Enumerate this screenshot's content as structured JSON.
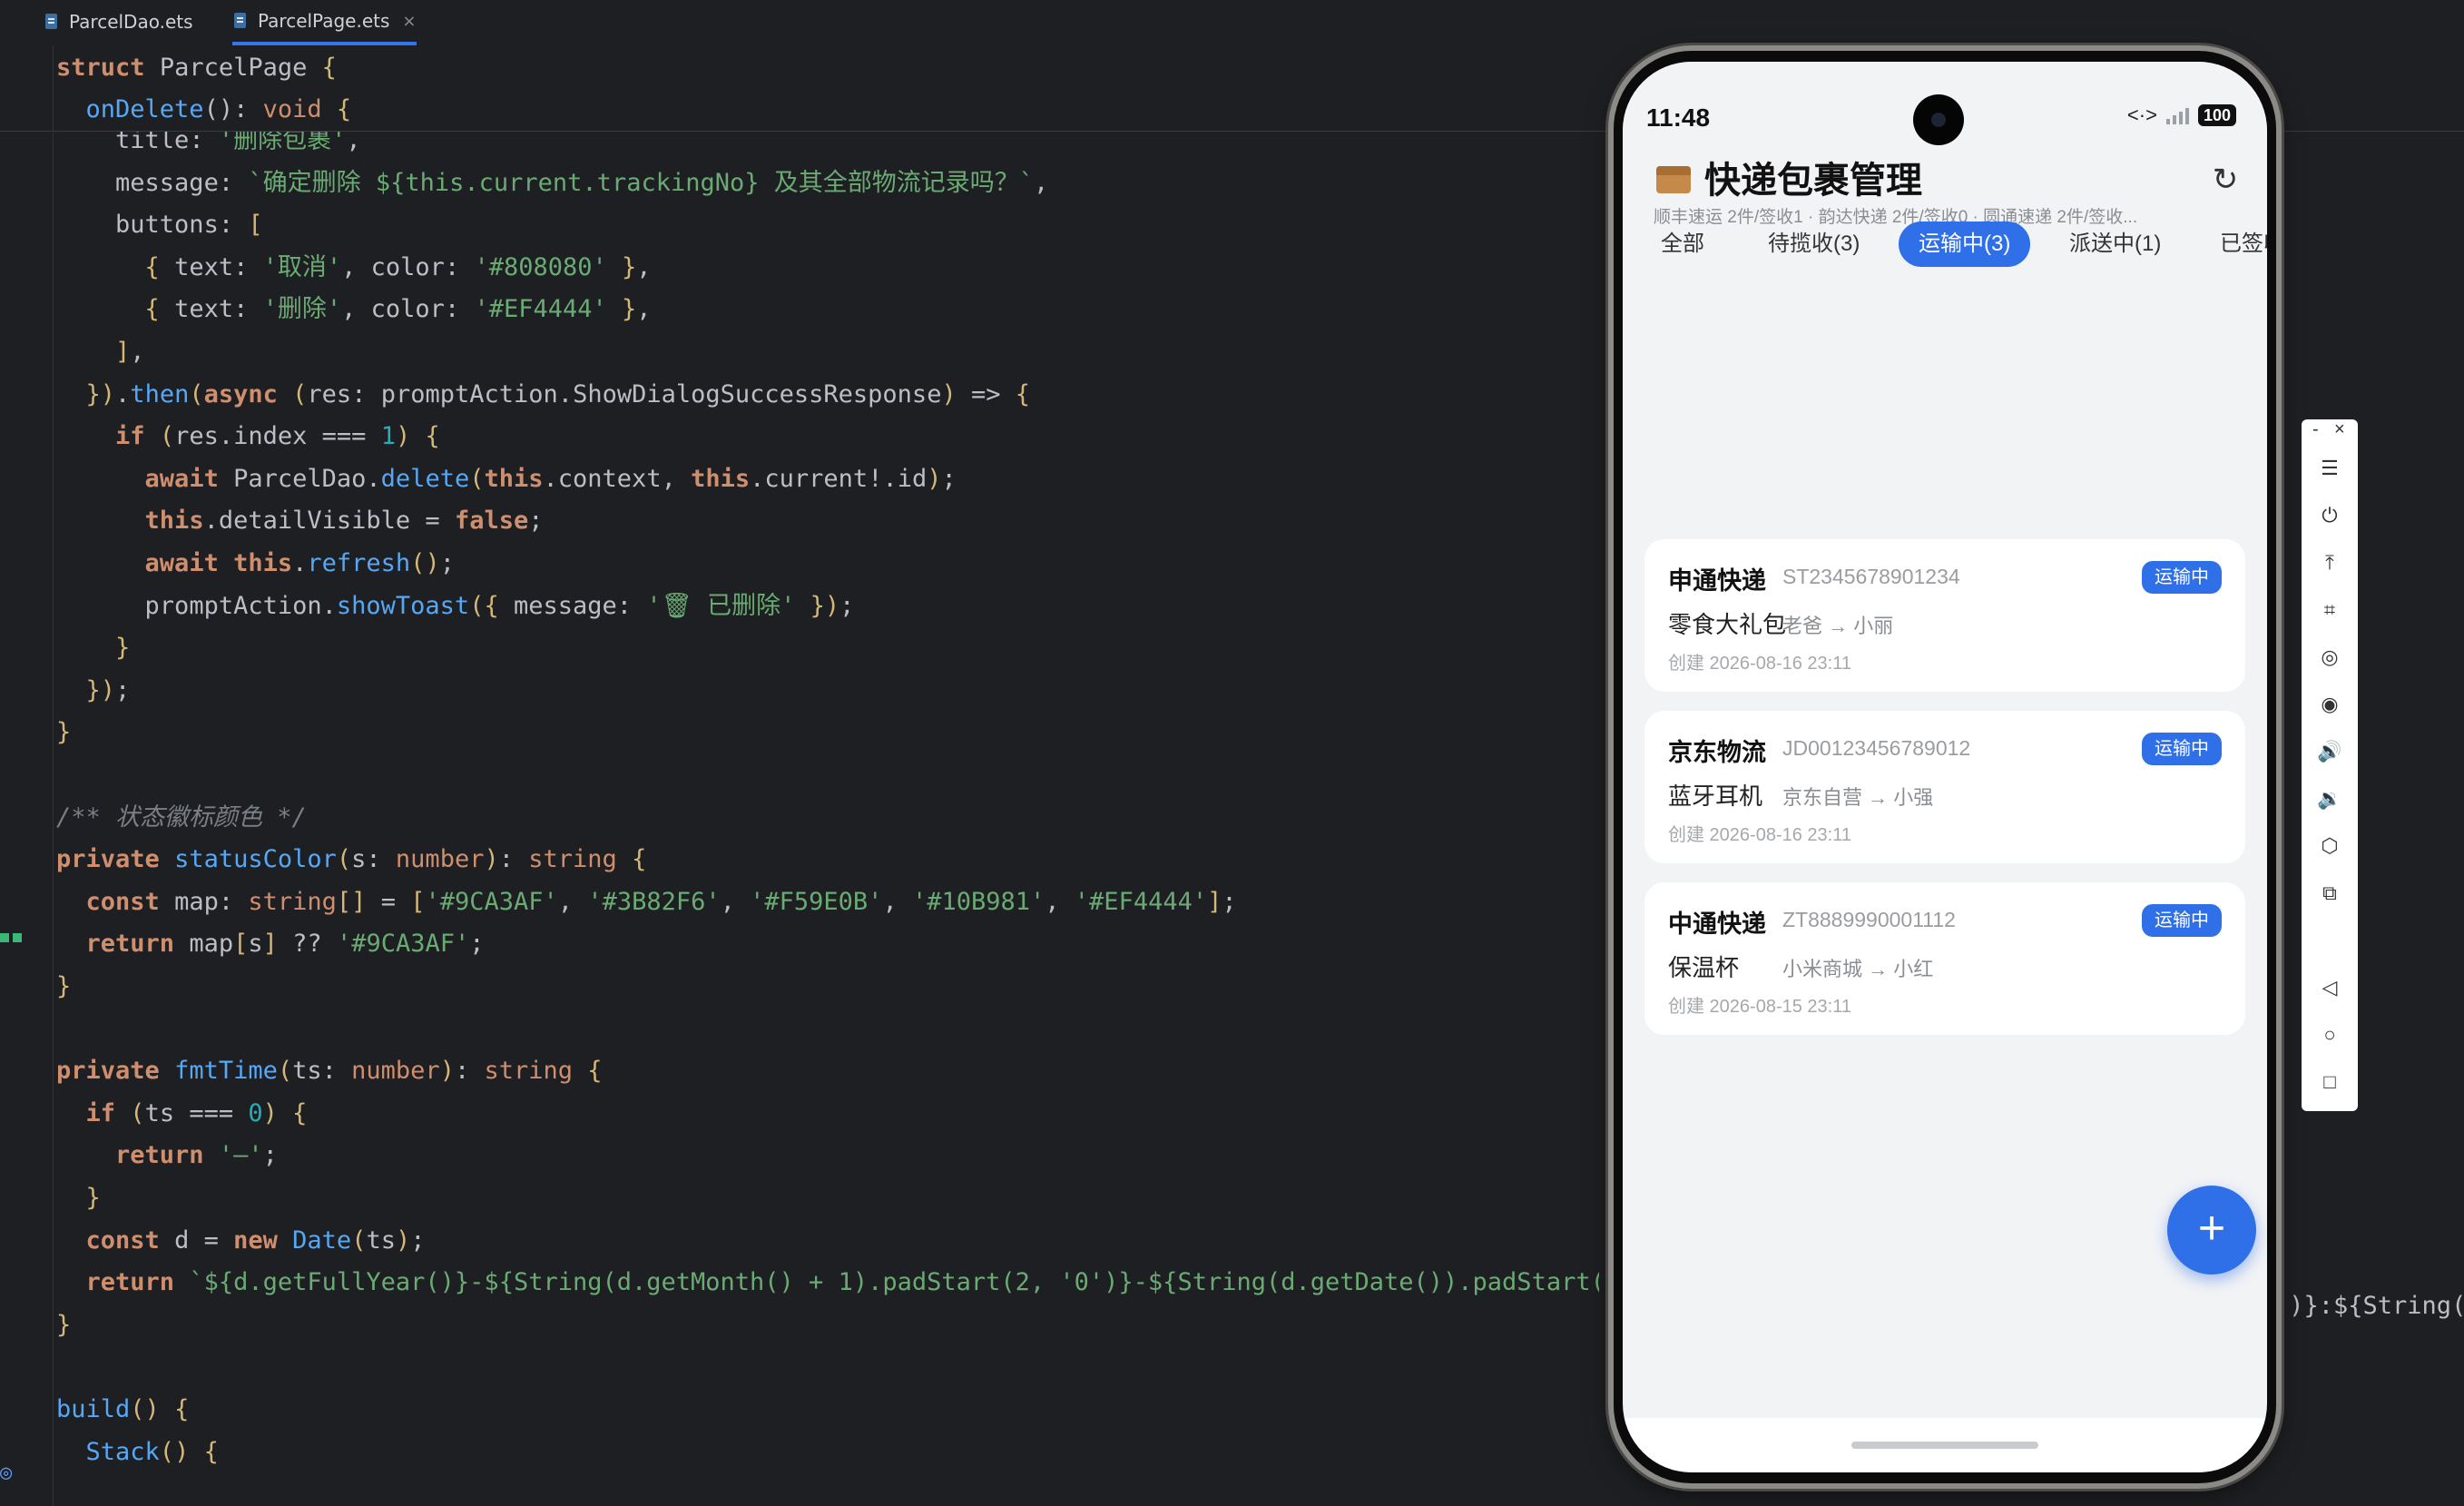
{
  "ide": {
    "tabs": [
      {
        "label": "ParcelDao.ets",
        "active": false
      },
      {
        "label": "ParcelPage.ets",
        "active": true,
        "close": "×"
      }
    ],
    "sticky": [
      "struct ParcelPage {",
      "  onDelete(): void {"
    ],
    "code": [
      "    title: '删除包裹',",
      "    message: `确定删除 ${this.current.trackingNo} 及其全部物流记录吗？`,",
      "    buttons: [",
      "      { text: '取消', color: '#808080' },",
      "      { text: '删除', color: '#EF4444' },",
      "    ],",
      "  }).then(async (res: promptAction.ShowDialogSuccessResponse) => {",
      "    if (res.index === 1) {",
      "      await ParcelDao.delete(this.context, this.current!.id);",
      "      this.detailVisible = false;",
      "      await this.refresh();",
      "      promptAction.showToast({ message: '🗑 已删除' });",
      "    }",
      "  });",
      "}",
      "",
      "/** 状态徽标颜色 */",
      "private statusColor(s: number): string {",
      "  const map: string[] = ['#9CA3AF', '#3B82F6', '#F59E0B', '#10B981', '#EF4444'];",
      "  return map[s] ?? '#9CA3AF';",
      "}",
      "",
      "private fmtTime(ts: number): string {",
      "  if (ts === 0) {",
      "    return '—';",
      "  }",
      "  const d = new Date(ts);",
      "  return `${d.getFullYear()}-${String(d.getMonth() + 1).padStart(2, '0')}-${String(d.getDate()).padStart(",
      "}",
      "",
      "build() {",
      "  Stack() {"
    ],
    "code_overflow_fragment": "')}:${String("
  },
  "phone": {
    "status": {
      "time": "11:48",
      "network": "<·>",
      "battery": "100"
    },
    "app_title": "快递包裹管理",
    "subtitle": "顺丰速运 2件/签收1 · 韵达快递 2件/签收0 · 圆通速递 2件/签收...",
    "refresh_icon": "↻",
    "filters": [
      {
        "label": "全部",
        "active": false
      },
      {
        "label": "待揽收(3)",
        "active": false
      },
      {
        "label": "运输中(3)",
        "active": true
      },
      {
        "label": "派送中(1)",
        "active": false
      },
      {
        "label": "已签收",
        "active": false
      }
    ],
    "parcels": [
      {
        "carrier": "申通快递",
        "tracking": "ST2345678901234",
        "status": "运输中",
        "item": "零食大礼包",
        "route": "老爸 → 小丽",
        "created": "创建 2026-08-16 23:11"
      },
      {
        "carrier": "京东物流",
        "tracking": "JD00123456789012",
        "status": "运输中",
        "item": "蓝牙耳机",
        "route": "京东自营 → 小强",
        "created": "创建 2026-08-16 23:11"
      },
      {
        "carrier": "中通快递",
        "tracking": "ZT8889990001112",
        "status": "运输中",
        "item": "保温杯",
        "route": "小米商城 → 小红",
        "created": "创建 2026-08-15 23:11"
      }
    ],
    "fab_label": "+",
    "accent": "#2F6FE8"
  },
  "emulator_toolbar": {
    "window_buttons": [
      "-",
      "×"
    ],
    "tools": [
      "☰",
      "⏻",
      "⤒",
      "⌗",
      "◎",
      "◉",
      "🔊",
      "🔉",
      "⬡",
      "⧉",
      "◁",
      "○",
      "□"
    ]
  }
}
